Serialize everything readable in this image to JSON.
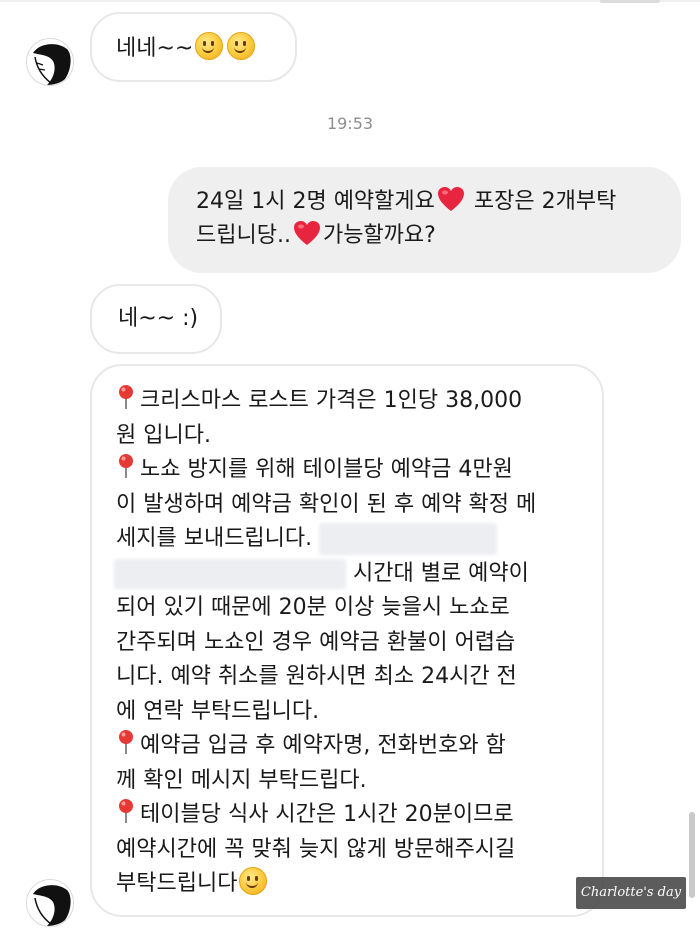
{
  "messages": {
    "m1": {
      "text": "네네~~"
    },
    "timestamp": "19:53",
    "m2": {
      "line1_a": "24일 1시 2명 예약할게요",
      "line1_b": " 포장은 2개부탁",
      "line2_a": "드립니당..",
      "line2_b": "가능할까요?"
    },
    "m3": {
      "text": "네~~ :)"
    },
    "m4": {
      "l1": "크리스마스 로스트 가격은 1인당 38,000",
      "l2": "원 입니다.",
      "l3": "노쇼 방지를 위해 테이블당 예약금 4만원",
      "l4": "이 발생하며 예약금 확인이 된 후 예약 확정 메",
      "l5": "세지를 보내드립니다.",
      "l6": "시간대 별로 예약이",
      "l7": "되어 있기 때문에 20분 이상 늦을시 노쇼로",
      "l8": "간주되며 노쇼인 경우 예약금 환불이 어렵습",
      "l9": "니다. 예약 취소를 원하시면 최소 24시간 전",
      "l10": "에 연락 부탁드립니다.",
      "l11": "예약금 입금 후 예약자명, 전화번호와 함",
      "l12": "께 확인 메시지 부탁드립다.",
      "l13": "테이블당 식사 시간은 1시간 20분이므로",
      "l14": "예약시간에 꼭 맞춰 늦지 않게 방문해주시길",
      "l15": "부탁드립니다"
    }
  },
  "watermark": "Charlotte's day :)",
  "icons": {
    "smile": "smiling-face-icon",
    "heart": "red-heart-icon",
    "pin": "round-pushpin-icon",
    "avatar": "profile-avatar-icon"
  },
  "colors": {
    "outgoing_bubble": "#efefef",
    "incoming_border": "#e8e8e8",
    "timestamp": "#8e8e8e",
    "heart": "#e0245e",
    "pin": "#e53935"
  }
}
